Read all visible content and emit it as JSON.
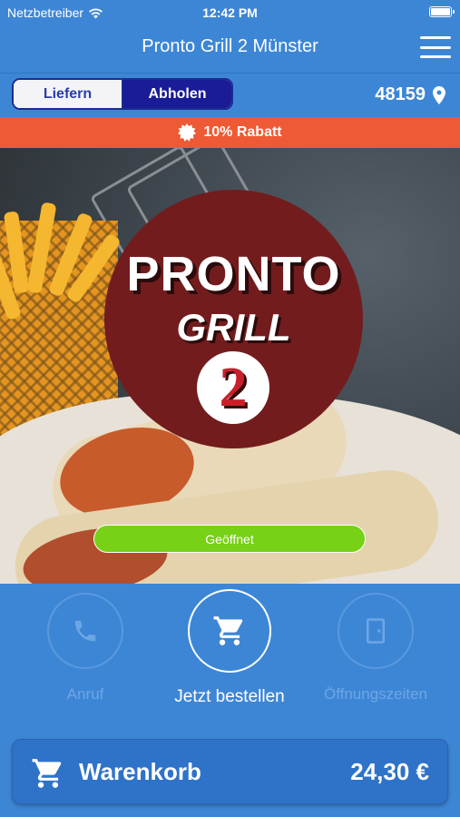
{
  "status_bar": {
    "carrier": "Netzbetreiber",
    "time": "12:42 PM"
  },
  "header": {
    "title": "Pronto Grill 2 Münster"
  },
  "order_mode": {
    "options": [
      "Liefern",
      "Abholen"
    ],
    "selected": "Abholen"
  },
  "location": {
    "plz": "48159"
  },
  "discount": {
    "label": "10% Rabatt"
  },
  "logo": {
    "line1": "PRONTO",
    "line2": "GRILL",
    "number": "2"
  },
  "open_status": {
    "label": "Geöffnet"
  },
  "actions": [
    {
      "label": "Anruf",
      "icon": "phone-icon"
    },
    {
      "label": "Jetzt bestellen",
      "icon": "cart-icon"
    },
    {
      "label": "Öffnungszeiten",
      "icon": "door-icon"
    }
  ],
  "cart": {
    "label": "Warenkorb",
    "total": "24,30 €"
  },
  "colors": {
    "primary": "#3d86d6",
    "accent_orange": "#ee5a35",
    "toggle_active": "#1a1b96",
    "open_green": "#76d117",
    "logo_red": "#731c1e"
  }
}
